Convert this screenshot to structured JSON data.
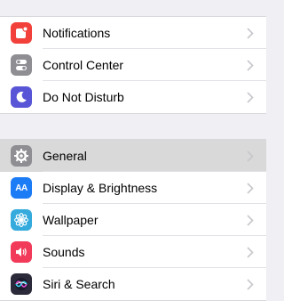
{
  "colors": {
    "notifications": "#f2403a",
    "control_center": "#8e8e93",
    "do_not_disturb": "#5856d6",
    "general": "#8e8e93",
    "display": "#1c7cf5",
    "wallpaper": "#35aadc",
    "sounds": "#f23a5a",
    "siri": "#2a2a3a",
    "chevron": "#c7c7cc"
  },
  "group1": {
    "items": [
      {
        "label": "Notifications",
        "icon": "notifications-icon"
      },
      {
        "label": "Control Center",
        "icon": "control-center-icon"
      },
      {
        "label": "Do Not Disturb",
        "icon": "moon-icon"
      }
    ]
  },
  "group2": {
    "items": [
      {
        "label": "General",
        "icon": "gear-icon",
        "selected": true
      },
      {
        "label": "Display & Brightness",
        "icon": "display-brightness-icon",
        "icon_text": "AA"
      },
      {
        "label": "Wallpaper",
        "icon": "wallpaper-flower-icon"
      },
      {
        "label": "Sounds",
        "icon": "speaker-icon"
      },
      {
        "label": "Siri & Search",
        "icon": "siri-icon"
      }
    ]
  }
}
